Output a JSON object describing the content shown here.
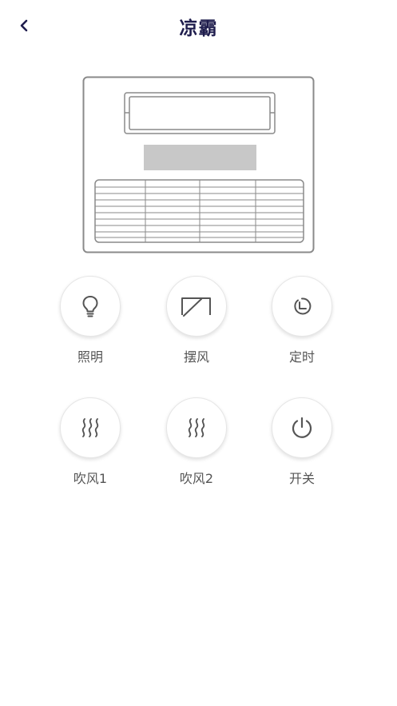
{
  "header": {
    "title": "凉霸",
    "back_icon": "chevron-left-icon"
  },
  "device_illustration": "ceiling-fan-unit",
  "controls": [
    {
      "id": "light",
      "label": "照明",
      "icon": "lightbulb-icon"
    },
    {
      "id": "swing",
      "label": "摆风",
      "icon": "swing-icon"
    },
    {
      "id": "timer",
      "label": "定时",
      "icon": "clock-icon"
    },
    {
      "id": "blow1",
      "label": "吹风1",
      "icon": "wind-waves-icon"
    },
    {
      "id": "blow2",
      "label": "吹风2",
      "icon": "wind-waves-icon"
    },
    {
      "id": "power",
      "label": "开关",
      "icon": "power-icon"
    }
  ],
  "colors": {
    "title": "#1f1d4d",
    "label": "#555555",
    "icon_stroke": "#555555",
    "device_stroke": "#8a8a8a",
    "device_panel": "#c8c8c8"
  }
}
